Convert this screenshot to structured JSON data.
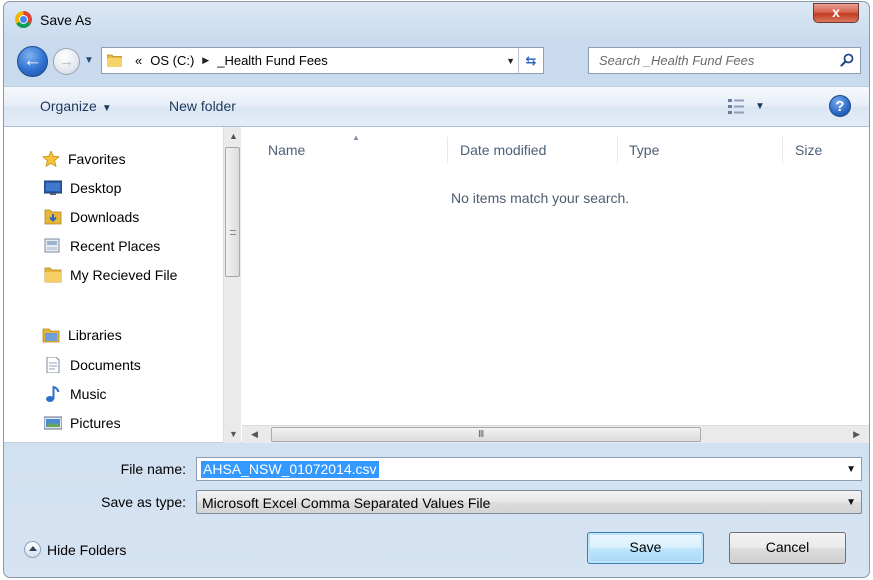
{
  "window": {
    "title": "Save As",
    "close_glyph": "x"
  },
  "navigation": {
    "back_glyph": "←",
    "forward_glyph": "→",
    "history_glyph": "▼",
    "breadcrumb": {
      "overflow": "«",
      "items": [
        "OS (C:)",
        "_Health Fund Fees"
      ],
      "separator": "▶"
    },
    "refresh_glyph": "⇆",
    "search": {
      "placeholder": "Search _Health Fund Fees",
      "value": ""
    }
  },
  "toolbar": {
    "organize_label": "Organize",
    "new_folder_label": "New folder",
    "caret": "▼",
    "help_glyph": "?"
  },
  "nav_pane": {
    "favorites_label": "Favorites",
    "favorites": [
      {
        "label": "Desktop",
        "icon": "desktop-icon"
      },
      {
        "label": "Downloads",
        "icon": "downloads-folder-icon"
      },
      {
        "label": "Recent Places",
        "icon": "recent-places-icon"
      },
      {
        "label": "My Recieved File",
        "icon": "folder-icon"
      }
    ],
    "libraries_label": "Libraries",
    "libraries": [
      {
        "label": "Documents",
        "icon": "documents-icon"
      },
      {
        "label": "Music",
        "icon": "music-icon"
      },
      {
        "label": "Pictures",
        "icon": "pictures-icon"
      }
    ]
  },
  "file_list": {
    "columns": [
      "Name",
      "Date modified",
      "Type",
      "Size"
    ],
    "empty_message": "No items match your search.",
    "h_scroll_grip": "III"
  },
  "form": {
    "file_name_label": "File name:",
    "file_name_value": "AHSA_NSW_01072014.csv",
    "save_type_label": "Save as type:",
    "save_type_value": "Microsoft Excel Comma Separated Values File"
  },
  "footer": {
    "hide_folders_label": "Hide Folders",
    "save_label": "Save",
    "cancel_label": "Cancel"
  },
  "colors": {
    "selection": "#3399ff",
    "window_frame": "#cfdff0",
    "close_button": "#c23b22"
  }
}
